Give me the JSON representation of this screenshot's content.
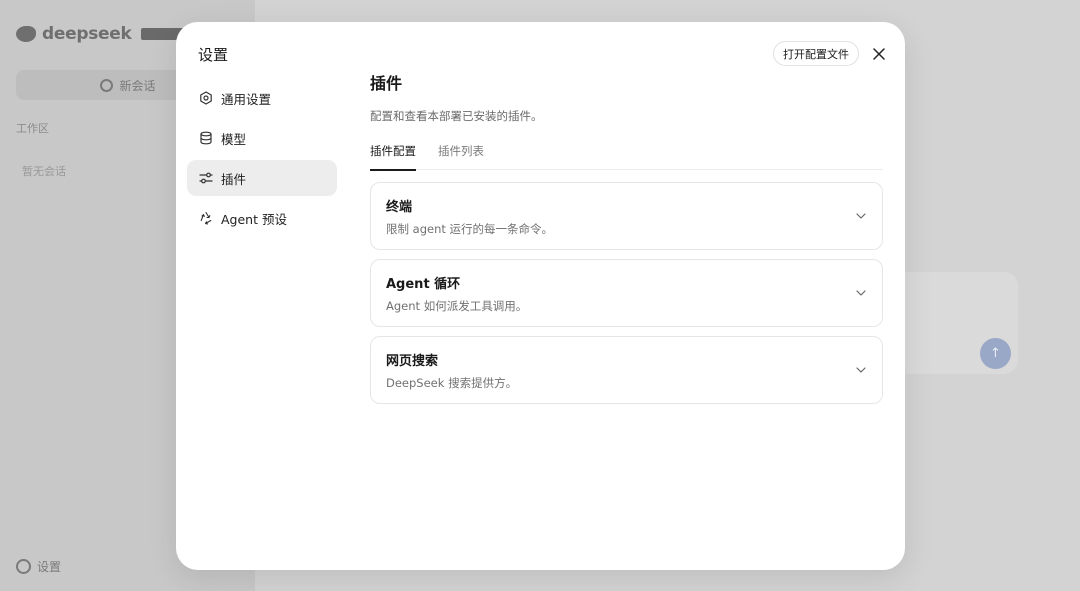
{
  "background": {
    "logo_text": "deepseek",
    "new_chat_label": "新会话",
    "section_label": "工作区",
    "empty_label": "暂无会话",
    "settings_label": "设置",
    "send_icon": "arrow-up-icon"
  },
  "modal": {
    "title": "设置",
    "open_config_label": "打开配置文件",
    "close_icon": "close-icon",
    "nav": [
      {
        "label": "通用设置",
        "icon": "gear-icon",
        "active": false
      },
      {
        "label": "模型",
        "icon": "database-icon",
        "active": false
      },
      {
        "label": "插件",
        "icon": "sliders-icon",
        "active": true
      },
      {
        "label": "Agent 预设",
        "icon": "recycle-icon",
        "active": false
      }
    ],
    "content": {
      "title": "插件",
      "description": "配置和查看本部署已安装的插件。",
      "tabs": [
        {
          "label": "插件配置",
          "active": true
        },
        {
          "label": "插件列表",
          "active": false
        }
      ],
      "cards": [
        {
          "title": "终端",
          "description": "限制 agent 运行的每一条命令。"
        },
        {
          "title": "Agent 循环",
          "description": "Agent 如何派发工具调用。"
        },
        {
          "title": "网页搜索",
          "description": "DeepSeek 搜索提供方。"
        }
      ]
    }
  },
  "colors": {
    "overlay": "#cfcfcf",
    "modal_bg": "#ffffff",
    "active_nav_bg": "#ededed",
    "text_primary": "#1a1a1a",
    "text_secondary": "#6b6b6b",
    "send_button": "#9aa8c8"
  }
}
